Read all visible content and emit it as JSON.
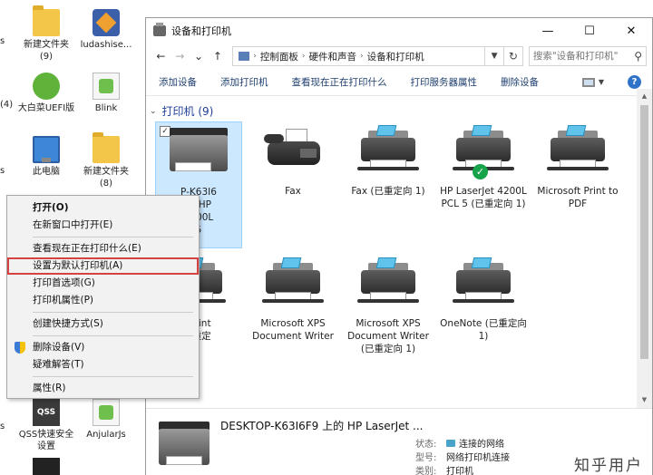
{
  "desktop": {
    "icons": [
      {
        "label": "新建文件夹 (9)",
        "icon": "folder-icon"
      },
      {
        "label": "ludashise...",
        "icon": "app-icon"
      },
      {
        "label": "大白菜UEFI版",
        "icon": "green-app-icon"
      },
      {
        "label": "Blink",
        "icon": "file-icon"
      },
      {
        "label": "此电脑",
        "icon": "computer-icon"
      },
      {
        "label": "新建文件夹 (8)",
        "icon": "folder-icon"
      },
      {
        "label": "QSS快速安全设置",
        "icon": "qss-icon"
      },
      {
        "label": "AnjularJs",
        "icon": "file-icon"
      }
    ],
    "edge_labels": [
      "s",
      "(4)",
      "s",
      "s"
    ]
  },
  "window": {
    "title": "设备和打印机",
    "min": "—",
    "max": "☐",
    "close": "✕",
    "nav": {
      "back": "←",
      "forward": "→",
      "dropdown": "⌄",
      "up": "↑"
    },
    "breadcrumb": [
      "控制面板",
      "硬件和声音",
      "设备和打印机"
    ],
    "breadcrumb_sep": "›",
    "search_placeholder": "搜索\"设备和打印机\"",
    "commands": [
      "添加设备",
      "添加打印机",
      "查看现在正在打印什么",
      "打印服务器属性",
      "删除设备"
    ],
    "help": "?",
    "group_label": "打印机 (9)",
    "printers": [
      {
        "name": "P-K63I6\n的 HP\n4200L\n5",
        "type": "mfp",
        "selected": true,
        "default": false
      },
      {
        "name": "Fax",
        "type": "fax",
        "selected": false,
        "default": false
      },
      {
        "name": "Fax (已重定向 1)",
        "type": "printer",
        "selected": false,
        "default": false
      },
      {
        "name": "HP LaserJet 4200L PCL 5 (已重定向 1)",
        "type": "printer",
        "selected": false,
        "default": true
      },
      {
        "name": "Microsoft Print to PDF",
        "type": "printer",
        "selected": false,
        "default": false
      },
      {
        "name": "ft Print\n(已重定\n1)",
        "type": "printer",
        "selected": false,
        "default": false
      },
      {
        "name": "Microsoft XPS Document Writer",
        "type": "printer",
        "selected": false,
        "default": false
      },
      {
        "name": "Microsoft XPS Document Writer (已重定向 1)",
        "type": "printer",
        "selected": false,
        "default": false
      },
      {
        "name": "OneNote (已重定向 1)",
        "type": "printer",
        "selected": false,
        "default": false
      }
    ],
    "details": {
      "name": "DESKTOP-K63I6F9 上的 HP LaserJet ...",
      "rows": [
        {
          "key": "状态:",
          "value": "连接的网络"
        },
        {
          "key": "型号:",
          "value": "网络打印机连接"
        },
        {
          "key": "类别:",
          "value": "打印机"
        }
      ]
    },
    "watermark": "知乎用户"
  },
  "context_menu": {
    "items": [
      {
        "label": "打开(O)",
        "bold": true
      },
      {
        "label": "在新窗口中打开(E)"
      },
      {
        "sep": true
      },
      {
        "label": "查看现在正在打印什么(E)"
      },
      {
        "label": "设置为默认打印机(A)",
        "highlighted": true
      },
      {
        "label": "打印首选项(G)"
      },
      {
        "label": "打印机属性(P)"
      },
      {
        "sep": true
      },
      {
        "label": "创建快捷方式(S)"
      },
      {
        "sep": true
      },
      {
        "label": "删除设备(V)",
        "icon": "shield-icon"
      },
      {
        "label": "疑难解答(T)"
      },
      {
        "sep": true
      },
      {
        "label": "属性(R)"
      }
    ]
  },
  "colors": {
    "accent": "#2f73c9",
    "highlight_border": "#d64242",
    "selection": "#cce8ff"
  }
}
